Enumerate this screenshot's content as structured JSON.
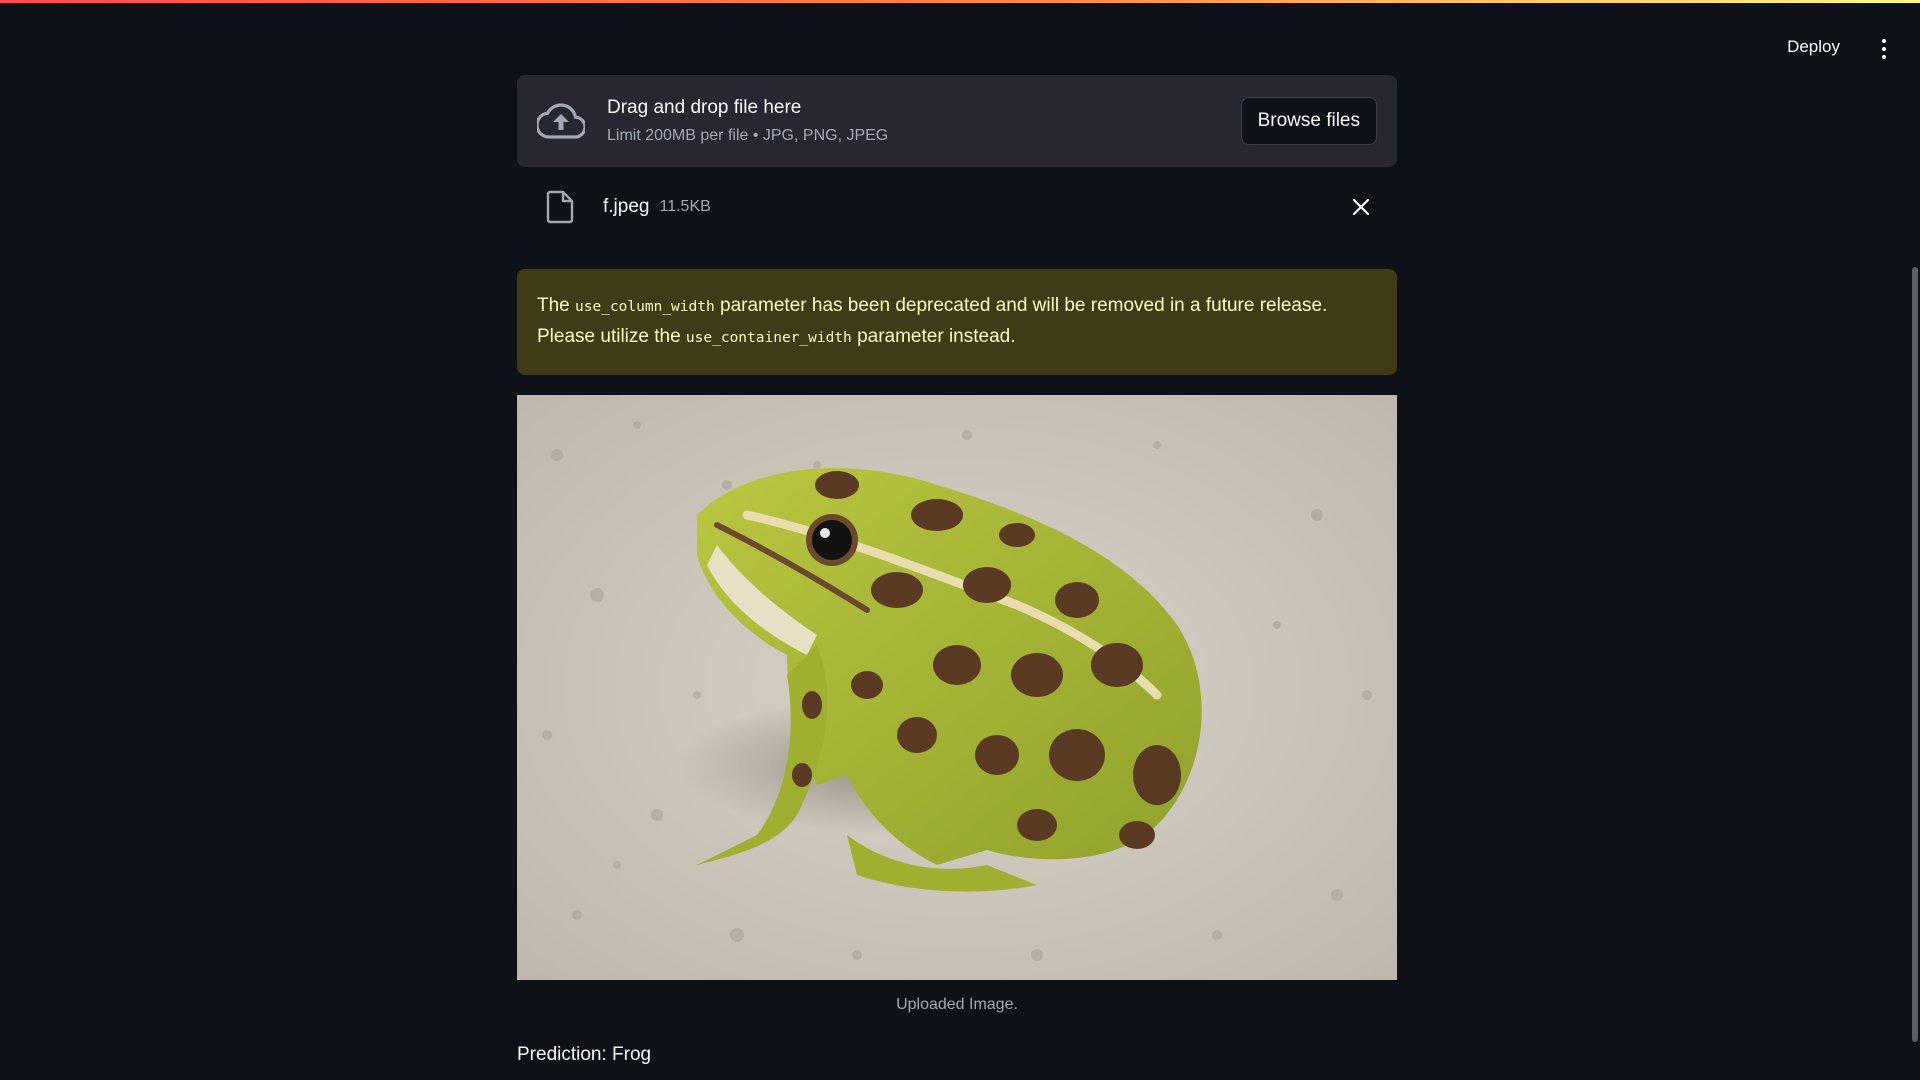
{
  "header": {
    "deploy_label": "Deploy",
    "menu_icon": "more-vert-icon"
  },
  "uploader": {
    "title": "Drag and drop file here",
    "limit": "Limit 200MB per file • JPG, PNG, JPEG",
    "browse_label": "Browse files",
    "icon": "cloud-upload-icon"
  },
  "file": {
    "name": "f.jpeg",
    "size": "11.5KB",
    "icon": "file-icon",
    "remove_icon": "close-icon"
  },
  "warning": {
    "part1": "The ",
    "code1": "use_column_width",
    "part2": " parameter has been deprecated and will be removed in a future release. Please utilize the ",
    "code2": "use_container_width",
    "part3": " parameter instead.",
    "background": "#3e3b16",
    "text_color": "#ffffc2"
  },
  "image": {
    "caption": "Uploaded Image."
  },
  "result": {
    "prediction": "Prediction: Frog"
  },
  "colors": {
    "background": "#0e1117",
    "panel": "#262730",
    "accent_gradient_start": "#ff4b4b",
    "accent_gradient_end": "#fffd80"
  }
}
